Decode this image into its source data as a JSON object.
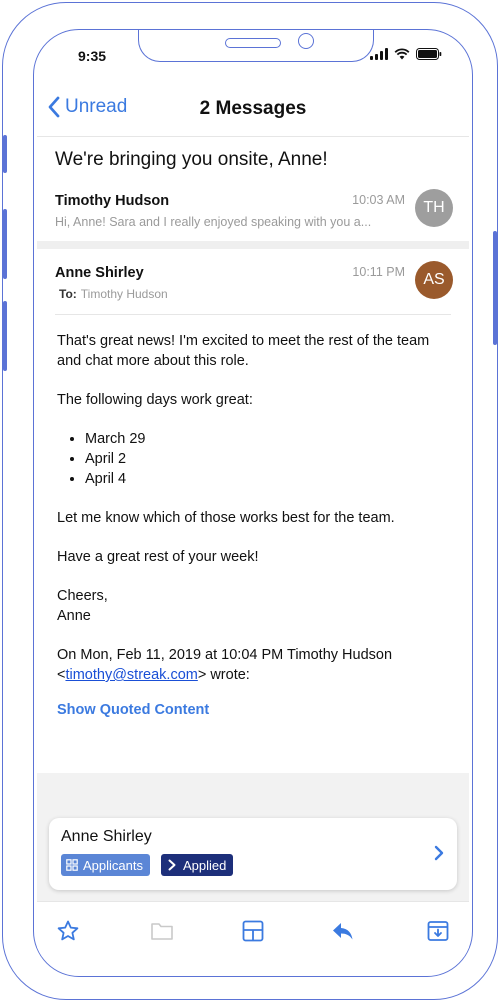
{
  "status_bar": {
    "time": "9:35"
  },
  "nav": {
    "back_label": "Unread",
    "title": "2 Messages"
  },
  "thread": {
    "subject": "We're bringing you onsite, Anne!",
    "messages": [
      {
        "sender": "Timothy Hudson",
        "time": "10:03 AM",
        "snippet": "Hi, Anne! Sara and I really enjoyed speaking with you a...",
        "initials": "TH",
        "avatar_color": "#9e9e9e"
      },
      {
        "sender": "Anne Shirley",
        "time": "10:11 PM",
        "to_label": "To:",
        "to": "Timothy Hudson",
        "initials": "AS",
        "avatar_color": "#9a5a2c",
        "body": {
          "p1": "That's great news! I'm excited to meet the rest of the team and chat more about this role.",
          "p2": "The following days work great:",
          "days": [
            "March 29",
            "April 2",
            "April 4"
          ],
          "p3": "Let me know which of those works best for the team.",
          "p4": "Have a great rest of your week!",
          "signoff": "Cheers,",
          "signature": "Anne",
          "quote_intro": "On Mon, Feb 11, 2019 at 10:04 PM Timothy Hudson",
          "quote_lt": "<",
          "quote_email": "timothy@streak.com",
          "quote_tail": "> wrote:"
        },
        "show_quoted": "Show Quoted Content"
      }
    ]
  },
  "crm_card": {
    "name": "Anne Shirley",
    "pipeline": "Applicants",
    "stage": "Applied",
    "pipeline_color": "#5b86d6",
    "stage_color": "#1d2f7a"
  },
  "toolbar_icons": [
    "star-icon",
    "folder-icon",
    "layout-icon",
    "reply-icon",
    "archive-icon"
  ],
  "colors": {
    "accent": "#3b7ae0",
    "frame": "#5b73d6",
    "link": "#1a4fd6"
  }
}
